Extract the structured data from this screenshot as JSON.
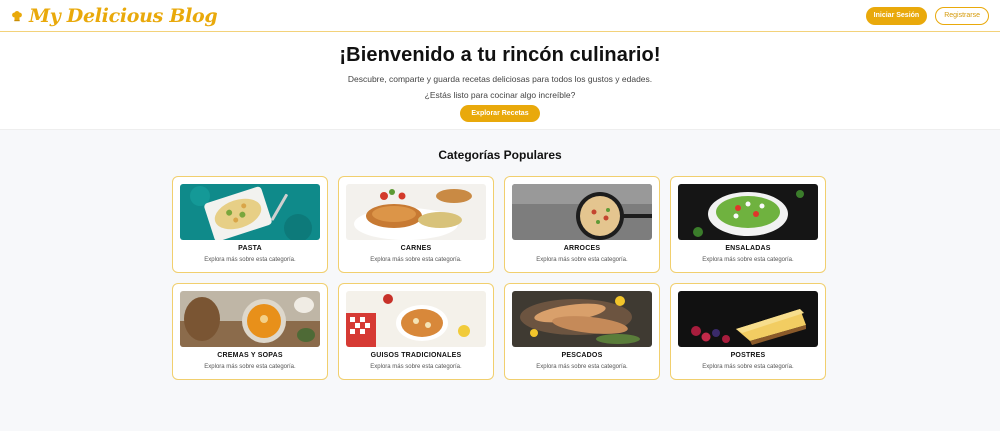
{
  "header": {
    "brand": "My Delicious Blog",
    "logo_icon": "chef-hat-icon",
    "login_label": "Iniciar Sesión",
    "register_label": "Registrarse"
  },
  "hero": {
    "title": "¡Bienvenido a tu rincón culinario!",
    "subtitle": "Descubre, comparte y guarda recetas deliciosas para todos los gustos y edades.",
    "question": "¿Estás listo para cocinar algo increíble?",
    "cta_label": "Explorar Recetas"
  },
  "categories": {
    "title": "Categorías Populares",
    "items": [
      {
        "name": "PASTA",
        "description": "Explora más sobre esta categoría.",
        "image": "pasta-dish-image"
      },
      {
        "name": "CARNES",
        "description": "Explora más sobre esta categoría.",
        "image": "grilled-chicken-image"
      },
      {
        "name": "ARROCES",
        "description": "Explora más sobre esta categoría.",
        "image": "rice-pan-image"
      },
      {
        "name": "ENSALADAS",
        "description": "Explora más sobre esta categoría.",
        "image": "salad-bowl-image"
      },
      {
        "name": "CREMAS Y SOPAS",
        "description": "Explora más sobre esta categoría.",
        "image": "pumpkin-soup-image"
      },
      {
        "name": "GUISOS TRADICIONALES",
        "description": "Explora más sobre esta categoría.",
        "image": "stew-bowl-image"
      },
      {
        "name": "PESCADOS",
        "description": "Explora más sobre esta categoría.",
        "image": "fish-platter-image"
      },
      {
        "name": "POSTRES",
        "description": "Explora más sobre esta categoría.",
        "image": "cheesecake-image"
      }
    ]
  },
  "colors": {
    "accent": "#e9a90b",
    "card_border": "#f1cf6e",
    "background": "#f7f8fa"
  }
}
